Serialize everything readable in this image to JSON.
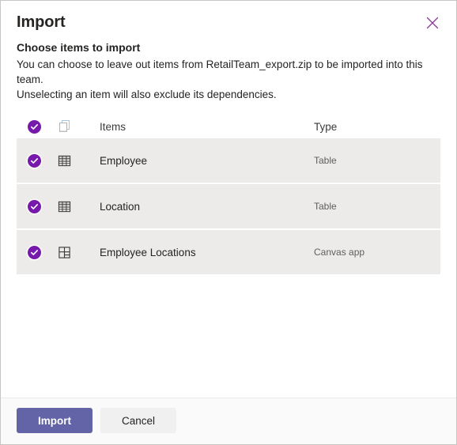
{
  "dialog": {
    "title": "Import",
    "close_label": "Close",
    "close_icon": "close-icon",
    "subtitle": "Choose items to import",
    "description_lines": [
      "You can choose to leave out items from RetailTeam_export.zip to be imported into this team.",
      "Unselecting an item will also exclude its dependencies."
    ]
  },
  "list": {
    "header": {
      "select_all_checked": true,
      "select_all_icon": "checkmark-circle-icon",
      "file_icon": "documents-stack-icon",
      "items_label": "Items",
      "type_label": "Type"
    },
    "rows": [
      {
        "checked": true,
        "check_icon": "checkmark-circle-icon",
        "icon": "table-grid-icon",
        "name": "Employee",
        "type": "Table"
      },
      {
        "checked": true,
        "check_icon": "checkmark-circle-icon",
        "icon": "table-grid-icon",
        "name": "Location",
        "type": "Table"
      },
      {
        "checked": true,
        "check_icon": "checkmark-circle-icon",
        "icon": "canvas-app-icon",
        "name": "Employee Locations",
        "type": "Canvas app"
      }
    ]
  },
  "footer": {
    "import_label": "Import",
    "cancel_label": "Cancel"
  },
  "colors": {
    "brand_purple": "#6264a7",
    "checkbox_purple": "#7719aa",
    "close_icon": "#8a3b96",
    "row_background": "#edebe9",
    "border": "#c8c6c4"
  }
}
